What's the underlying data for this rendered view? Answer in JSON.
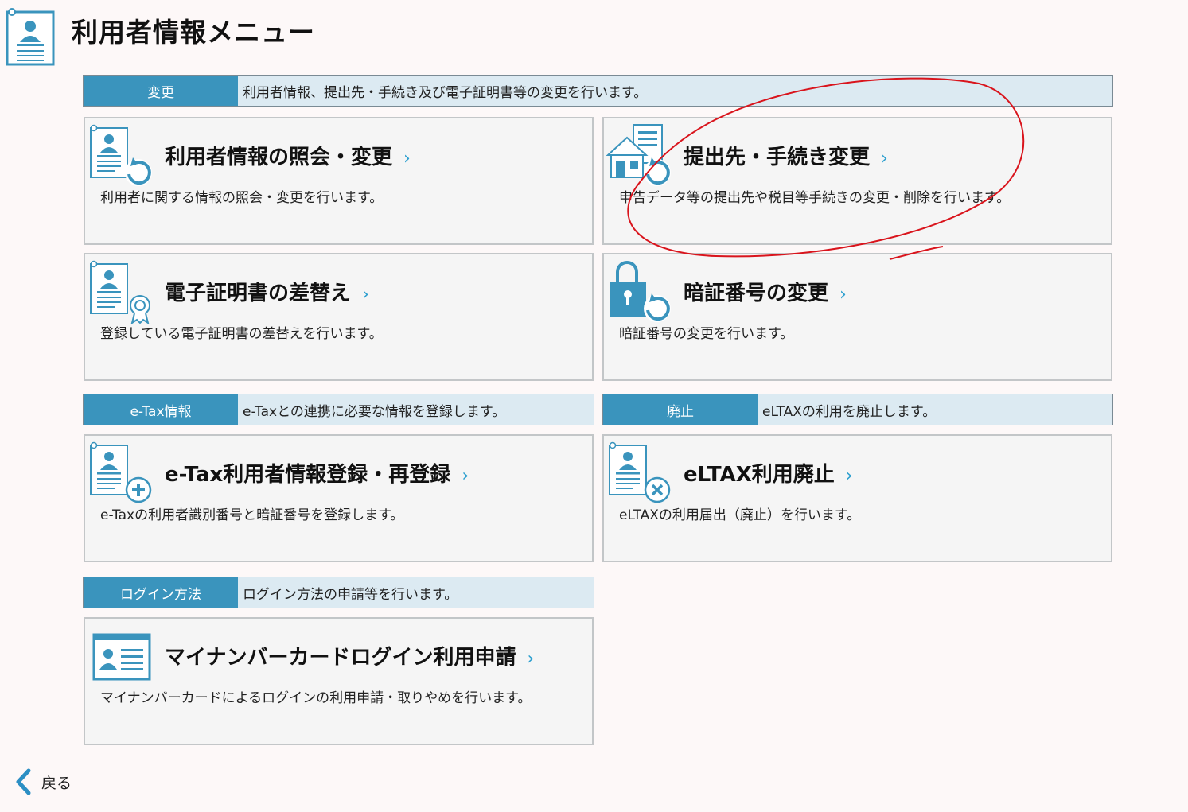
{
  "page": {
    "title": "利用者情報メニュー"
  },
  "sections": {
    "change": {
      "tag": "変更",
      "desc": "利用者情報、提出先・手続き及び電子証明書等の変更を行います。"
    },
    "etax": {
      "tag": "e-Tax情報",
      "desc": "e-Taxとの連携に必要な情報を登録します。"
    },
    "abolish": {
      "tag": "廃止",
      "desc": "eLTAXの利用を廃止します。"
    },
    "login": {
      "tag": "ログイン方法",
      "desc": "ログイン方法の申請等を行います。"
    }
  },
  "cards": {
    "user_info": {
      "title": "利用者情報の照会・変更",
      "desc": "利用者に関する情報の照会・変更を行います。"
    },
    "destination": {
      "title": "提出先・手続き変更",
      "desc": "申告データ等の提出先や税目等手続きの変更・削除を行います。"
    },
    "certificate": {
      "title": "電子証明書の差替え",
      "desc": "登録している電子証明書の差替えを行います。"
    },
    "pin": {
      "title": "暗証番号の変更",
      "desc": "暗証番号の変更を行います。"
    },
    "etax_register": {
      "title": "e-Tax利用者情報登録・再登録",
      "desc": "e-Taxの利用者識別番号と暗証番号を登録します。"
    },
    "eltax_abolish": {
      "title": "eLTAX利用廃止",
      "desc": "eLTAXの利用届出（廃止）を行います。"
    },
    "mynumber": {
      "title": "マイナンバーカードログイン利用申請",
      "desc": "マイナンバーカードによるログインの利用申請・取りやめを行います。"
    }
  },
  "chevron": "›",
  "back": {
    "label": "戻る"
  },
  "colors": {
    "accent": "#3a94bd",
    "bar_bg": "#dceaf2",
    "chevron": "#2c9fcf",
    "annotation": "#d9141c"
  }
}
